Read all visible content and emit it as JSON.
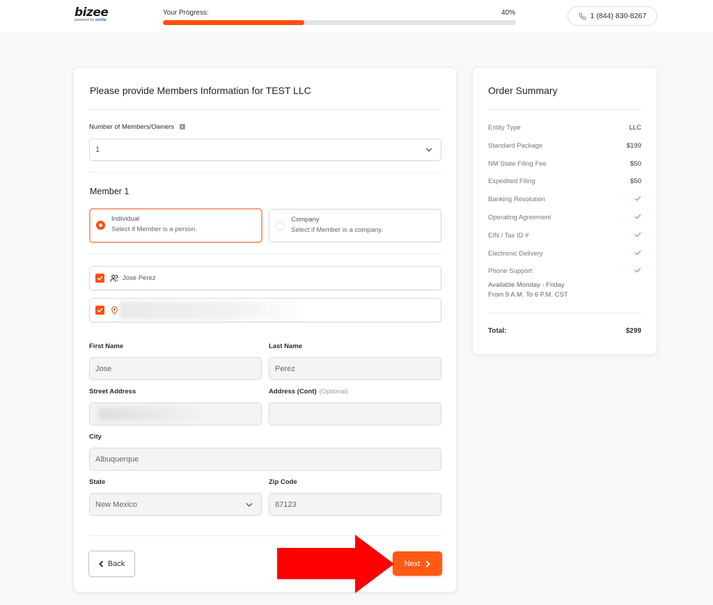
{
  "header": {
    "logo": {
      "name": "bizee",
      "powered_by_prefix": "powered by",
      "powered_by_brand": "incfile"
    },
    "progress": {
      "label": "Your Progress:",
      "percent_label": "40%",
      "value": 0.4
    },
    "phone": {
      "icon": "phone-icon",
      "number": "1 (844) 830-8267"
    }
  },
  "colors": {
    "accent": "#ff4f0f",
    "annotation_arrow": "#ff0000",
    "page_background": "#f8f8f8"
  },
  "form": {
    "title": "Please provide Members Information for TEST LLC",
    "members_count": {
      "label": "Number of Members/Owners",
      "info_icon": "info-icon",
      "value": "1"
    },
    "member_heading": "Member 1",
    "member_type": {
      "options": [
        {
          "title": "Individual",
          "description": "Select if Member is a person.",
          "selected": true
        },
        {
          "title": "Company",
          "description": "Select if Member is a company.",
          "selected": false
        }
      ]
    },
    "prefill": {
      "name_row": {
        "checked": true,
        "icon": "users-icon",
        "text": "Jose Perez"
      },
      "address_row": {
        "checked": true,
        "icon": "location-pin-icon",
        "text": ""
      }
    },
    "fields": {
      "first_name": {
        "label": "First Name",
        "value": "Jose"
      },
      "last_name": {
        "label": "Last Name",
        "value": "Perez"
      },
      "street_address": {
        "label": "Street Address",
        "value": ""
      },
      "address_cont": {
        "label": "Address (Cont)",
        "optional_label": "(Optional)",
        "value": ""
      },
      "city": {
        "label": "City",
        "value": "Albuquerque"
      },
      "state": {
        "label": "State",
        "value": "New Mexico"
      },
      "zip": {
        "label": "Zip Code",
        "value": "87123"
      }
    },
    "buttons": {
      "back": "Back",
      "next": "Next"
    }
  },
  "summary": {
    "title": "Order Summary",
    "rows": [
      {
        "label": "Entity Type",
        "value": "LLC",
        "type": "text"
      },
      {
        "label": "Standard Package",
        "value": "$199",
        "type": "text"
      },
      {
        "label": "NM State Filing Fee",
        "value": "$50",
        "type": "text"
      },
      {
        "label": "Expedited Filing",
        "value": "$50",
        "type": "text"
      },
      {
        "label": "Banking Resolution",
        "value": "included",
        "type": "check"
      },
      {
        "label": "Operating Agreement",
        "value": "included",
        "type": "check"
      },
      {
        "label": "EIN / Tax ID #",
        "value": "included",
        "type": "check"
      },
      {
        "label": "Electronic Delivery",
        "value": "included",
        "type": "check"
      },
      {
        "label": "Phone Support",
        "value": "included",
        "type": "check"
      }
    ],
    "note_line1": "Available Monday - Friday",
    "note_line2": "From 9 A.M. To 6 P.M. CST",
    "total_label": "Total:",
    "total_value": "$299"
  }
}
